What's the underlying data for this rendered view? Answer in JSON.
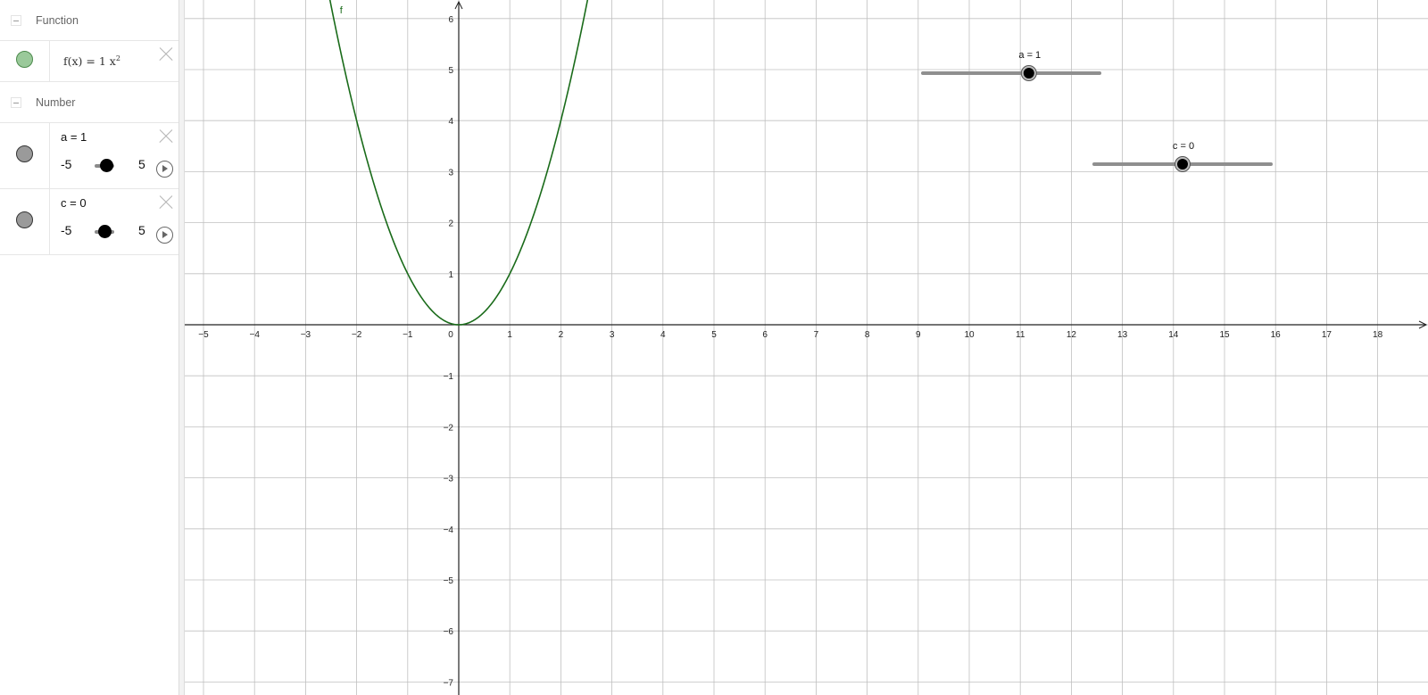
{
  "algebra": {
    "groups": [
      {
        "label": "Function"
      },
      {
        "label": "Number"
      }
    ],
    "function": {
      "name_part": "f(x) = 1 x",
      "exponent": "2",
      "marble_color": "#9ac99a"
    },
    "numbers": [
      {
        "definition": "a = 1",
        "min": "-5",
        "max": "5",
        "value": 1
      },
      {
        "definition": "c = 0",
        "min": "-5",
        "max": "5",
        "value": 0
      }
    ]
  },
  "graphics": {
    "function_label": "f",
    "curve_color": "#1a6b1a",
    "grid_color": "#c0c0c0",
    "x_ticks": [
      "-5",
      "-4",
      "-3",
      "-2",
      "-1",
      "0",
      "1",
      "2",
      "3",
      "4",
      "5",
      "6",
      "7",
      "8",
      "9",
      "10",
      "11",
      "12",
      "13",
      "14",
      "15",
      "16",
      "17",
      "18"
    ],
    "y_ticks": [
      "6",
      "5",
      "4",
      "3",
      "2",
      "1",
      "-1",
      "-2",
      "-3",
      "-4",
      "-5",
      "-6",
      "-7"
    ],
    "sliders": [
      {
        "label": "a = 1",
        "value": 1,
        "min": -5,
        "max": 5
      },
      {
        "label": "c = 0",
        "value": 0,
        "min": -5,
        "max": 5
      }
    ]
  }
}
